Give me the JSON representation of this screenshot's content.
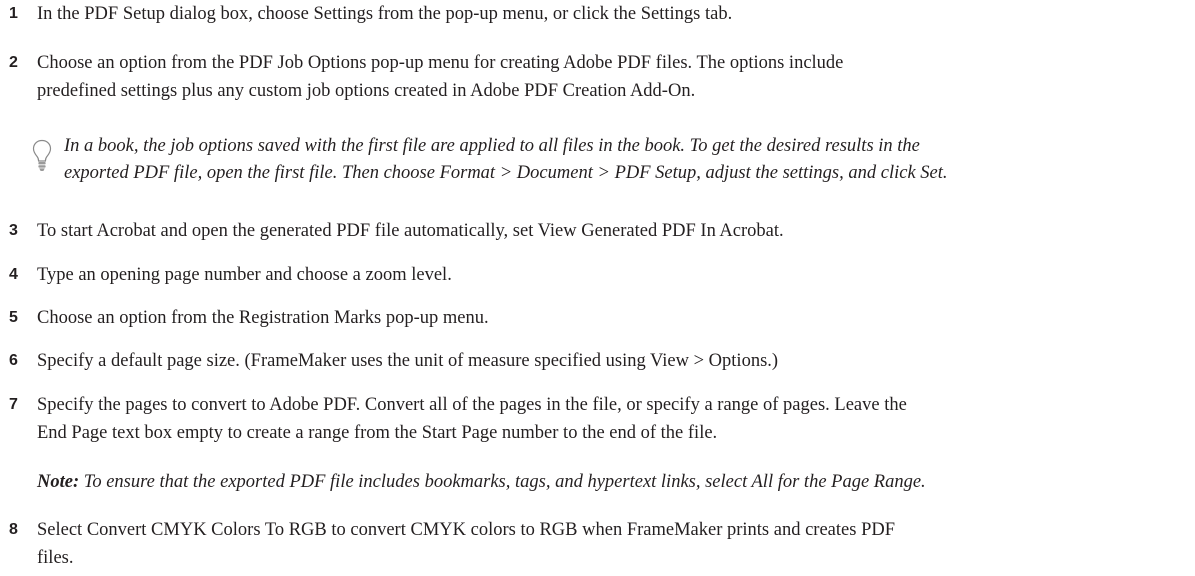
{
  "steps": [
    {
      "num": "1",
      "lines": [
        "In the PDF Setup dialog box, choose Settings from the pop-up menu, or click the Settings tab."
      ]
    },
    {
      "num": "2",
      "lines": [
        "Choose an option from the PDF Job Options pop-up menu for creating Adobe PDF files. The options include",
        "predefined settings plus any custom job options created in Adobe PDF Creation Add-On."
      ]
    },
    {
      "num": "3",
      "lines": [
        "To start Acrobat and open the generated PDF file automatically, set View Generated PDF In Acrobat."
      ]
    },
    {
      "num": "4",
      "lines": [
        "Type an opening page number and choose a zoom level."
      ]
    },
    {
      "num": "5",
      "lines": [
        "Choose an option from the Registration Marks pop-up menu."
      ]
    },
    {
      "num": "6",
      "lines": [
        "Specify a default page size. (FrameMaker uses the unit of measure specified using View > Options.)"
      ]
    },
    {
      "num": "7",
      "lines": [
        "Specify the pages to convert to Adobe PDF. Convert all of the pages in the file, or specify a range of pages. Leave the",
        "End Page text box empty to create a range from the Start Page number to the end of the file."
      ]
    },
    {
      "num": "8",
      "lines": [
        "Select Convert CMYK Colors To RGB to convert CMYK colors to RGB when FrameMaker prints and creates PDF",
        "files."
      ]
    }
  ],
  "tip": {
    "icon": "lightbulb-icon",
    "lines": [
      "In a book, the job options saved with the first file are applied to all files in the book. To get the desired results in the",
      "exported PDF file, open the first file. Then choose Format > Document > PDF Setup, adjust the settings, and click Set."
    ]
  },
  "note": {
    "label": "Note:",
    "text": " To ensure that the exported PDF file includes bookmarks, tags, and hypertext links, select All for the Page Range."
  }
}
